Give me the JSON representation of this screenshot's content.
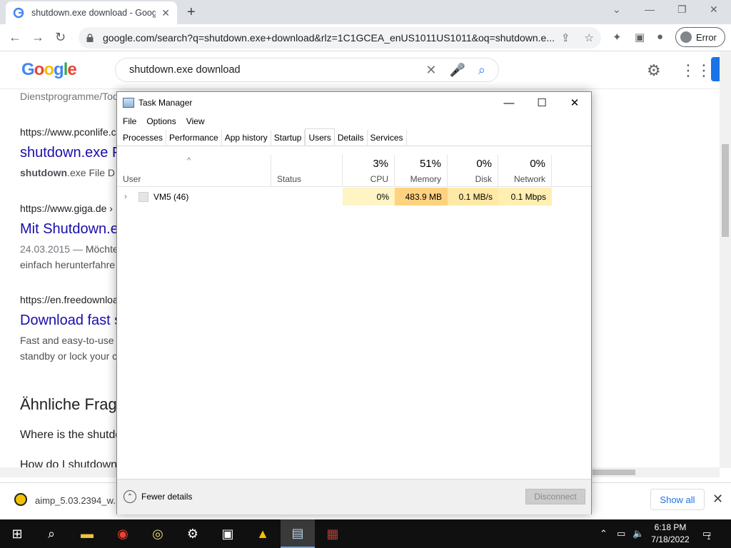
{
  "browser": {
    "tab_title": "shutdown.exe download - Googl",
    "url": "google.com/search?q=shutdown.exe+download&rlz=1C1GCEA_enUS1011US1011&oq=shutdown.e...",
    "profile_label": "Error"
  },
  "google": {
    "logo_text": "Google",
    "query": "shutdown.exe download"
  },
  "results": {
    "top_snip": "Dienstprogramme/Too",
    "r1_cite": "https://www.pconlife.co",
    "r1_title": "shutdown.exe F",
    "r1_snip_bold": "shutdown",
    "r1_snip_ext": ".exe",
    "r1_snip_rest": " File D",
    "r2_cite": "https://www.giga.de ›",
    "r2_title": "Mit Shutdown.e",
    "r2_snip_date": "24.03.2015 —",
    "r2_snip_a": " Möchte",
    "r2_snip_b": "einfach herunterfahre",
    "r3_cite": "https://en.freedownloa",
    "r3_title": "Download fast s",
    "r3_snip_a": "Fast and easy-to-use",
    "r3_snip_b": "standby or lock your c",
    "section_head": "Ähnliche Frag",
    "question1": "Where is the shutdo",
    "question2": "How do I shutdown"
  },
  "downloads": {
    "file": "aimp_5.03.2394_w....",
    "show_all": "Show all"
  },
  "task_manager": {
    "title": "Task Manager",
    "menu": [
      "File",
      "Options",
      "View"
    ],
    "tabs": [
      "Processes",
      "Performance",
      "App history",
      "Startup",
      "Users",
      "Details",
      "Services"
    ],
    "selected_tab": "Users",
    "columns": {
      "user": "User",
      "status": "Status",
      "cpu_pct": "3%",
      "cpu": "CPU",
      "mem_pct": "51%",
      "mem": "Memory",
      "disk_pct": "0%",
      "disk": "Disk",
      "net_pct": "0%",
      "net": "Network"
    },
    "row": {
      "user": "VM5 (46)",
      "status": "",
      "cpu": "0%",
      "memory": "483.9 MB",
      "disk": "0.1 MB/s",
      "network": "0.1 Mbps"
    },
    "fewer_details": "Fewer details",
    "disconnect": "Disconnect"
  },
  "taskbar": {
    "time": "6:18 PM",
    "date": "7/18/2022",
    "notification_count": "1",
    "apps": [
      "start",
      "search",
      "file-explorer",
      "chrome",
      "media-player",
      "settings",
      "7zip",
      "aimp",
      "task-manager",
      "winrar"
    ]
  },
  "colors": {
    "heat_cpu": "#fff4c4",
    "heat_mem": "#ffd27f",
    "heat_disk": "#ffe9a6",
    "heat_net": "#ffefb3",
    "link": "#1a0dab"
  }
}
